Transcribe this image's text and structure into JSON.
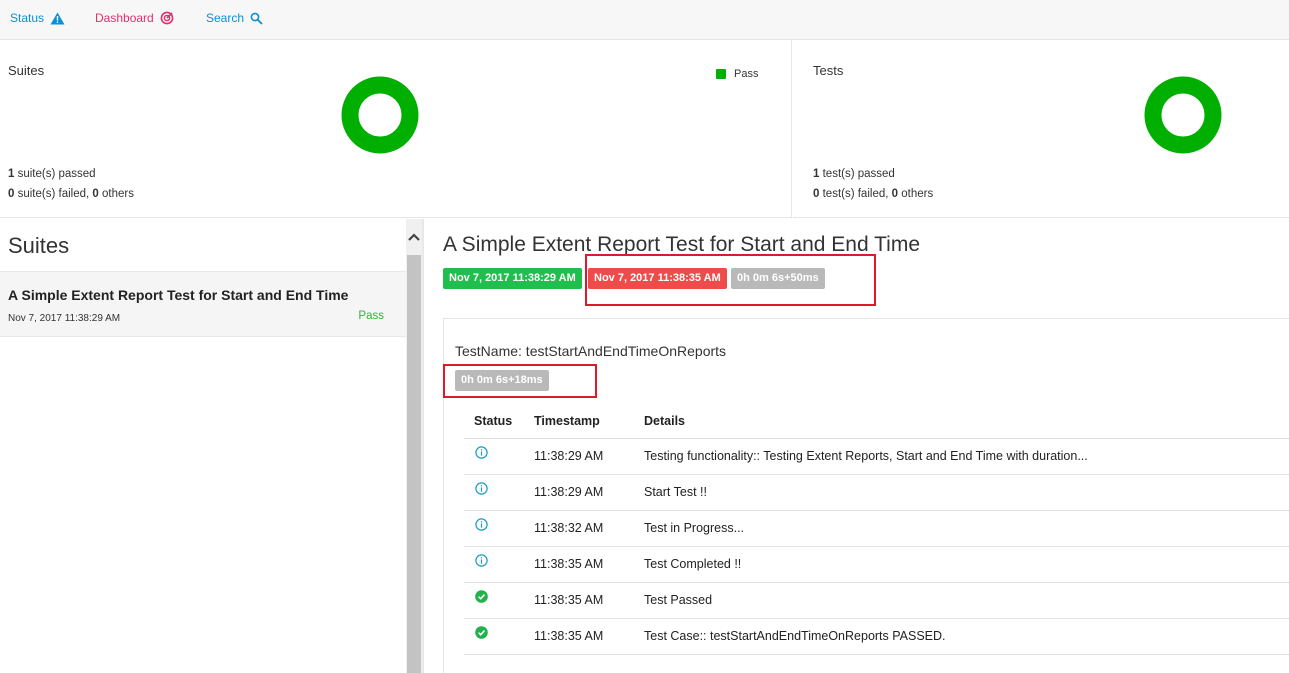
{
  "nav": {
    "status_label": "Status",
    "dashboard_label": "Dashboard",
    "search_label": "Search"
  },
  "dashboard": {
    "suites": {
      "title": "Suites",
      "legend_label": "Pass",
      "passed_count": "1",
      "passed_text": " suite(s) passed",
      "failed_count": "0",
      "failed_text": " suite(s) failed, ",
      "others_count": "0",
      "others_text": " others",
      "pass_ratio": 1.0
    },
    "tests": {
      "title": "Tests",
      "passed_count": "1",
      "passed_text": " test(s) passed",
      "failed_count": "0",
      "failed_text": " test(s) failed, ",
      "others_count": "0",
      "others_text": " others",
      "pass_ratio": 1.0
    }
  },
  "suite_list": {
    "title": "Suites",
    "items": [
      {
        "name": "A Simple Extent Report Test for Start and End Time",
        "time": "Nov 7, 2017 11:38:29 AM",
        "status": "Pass"
      }
    ]
  },
  "test": {
    "title": "A Simple Extent Report Test for Start and End Time",
    "start_time": "Nov 7, 2017 11:38:29 AM",
    "end_time": "Nov 7, 2017 11:38:35 AM",
    "duration": "0h 0m 6s+50ms",
    "node": {
      "name": "TestName: testStartAndEndTimeOnReports",
      "duration": "0h 0m 6s+18ms"
    },
    "log_headers": {
      "status": "Status",
      "timestamp": "Timestamp",
      "details": "Details"
    },
    "logs": [
      {
        "status_icon": "info-icon",
        "timestamp": "11:38:29 AM",
        "details": "Testing functionality:: Testing Extent Reports, Start and End Time with duration..."
      },
      {
        "status_icon": "info-icon",
        "timestamp": "11:38:29 AM",
        "details": "Start Test !!"
      },
      {
        "status_icon": "info-icon",
        "timestamp": "11:38:32 AM",
        "details": "Test in Progress..."
      },
      {
        "status_icon": "info-icon",
        "timestamp": "11:38:35 AM",
        "details": "Test Completed !!"
      },
      {
        "status_icon": "check-icon",
        "timestamp": "11:38:35 AM",
        "details": "Test Passed"
      },
      {
        "status_icon": "check-icon",
        "timestamp": "11:38:35 AM",
        "details": "Test Case:: testStartAndEndTimeOnReports PASSED."
      }
    ]
  },
  "colors": {
    "pass": "#00af00",
    "start_badge": "#1fbe4d",
    "end_badge": "#ef4b4b",
    "duration_badge": "#b9b9b9",
    "highlight": "#e0182d",
    "info": "#1a9bc8"
  }
}
